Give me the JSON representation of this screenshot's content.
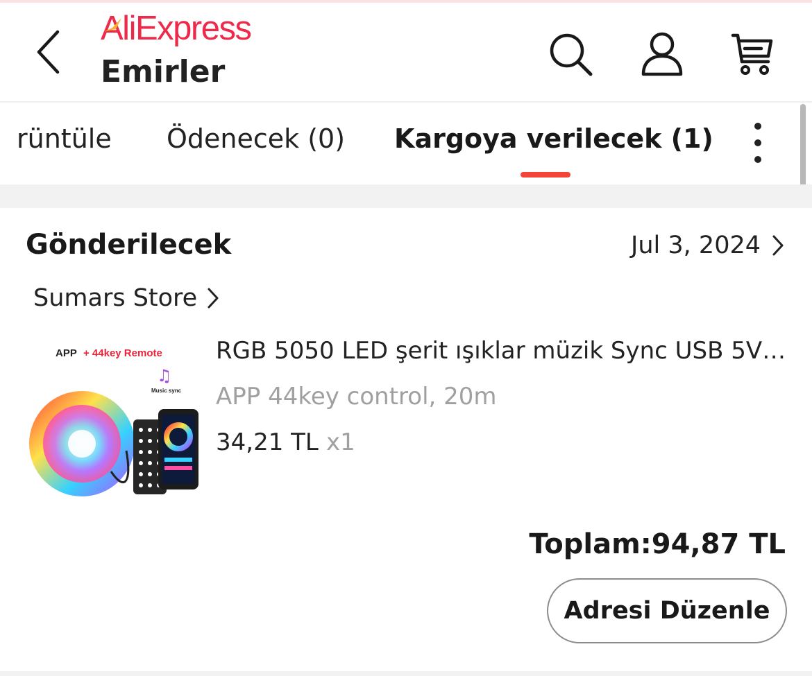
{
  "header": {
    "logo": "AliExpress",
    "title": "Emirler",
    "icons": [
      "back-chevron-icon",
      "search-icon",
      "account-icon",
      "cart-icon"
    ]
  },
  "tabs": [
    {
      "label": "rüntüle",
      "active": false
    },
    {
      "label": "Ödenecek (0)",
      "active": false
    },
    {
      "label": "Kargoya verilecek (1)",
      "active": true
    }
  ],
  "order": {
    "status": "Gönderilecek",
    "date": "Jul 3, 2024",
    "store": "Sumars Store",
    "product": {
      "image_caption_app": "APP",
      "image_caption_remote": "+ 44key Remote",
      "image_caption_music": "Music sync",
      "title": "RGB 5050 LED şerit ışıklar müzik Sync USB 5V u...",
      "variant": "APP 44key control, 20m",
      "price": "34,21 TL",
      "quantity": "x1"
    },
    "total": "Toplam:94,87 TL",
    "edit_address_label": "Adresi Düzenle"
  },
  "colors": {
    "brand": "#ee2a4a",
    "tab_indicator": "#f4443a",
    "muted_text": "#a0a0a0"
  }
}
